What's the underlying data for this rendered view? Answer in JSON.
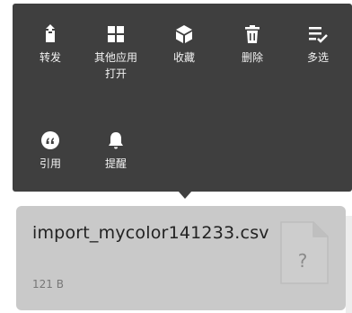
{
  "menu": {
    "items": [
      {
        "label": "转发",
        "icon": "share-icon"
      },
      {
        "label": "其他应用\n打开",
        "icon": "apps-icon"
      },
      {
        "label": "收藏",
        "icon": "favorite-box-icon"
      },
      {
        "label": "删除",
        "icon": "trash-icon"
      },
      {
        "label": "多选",
        "icon": "multi-select-icon"
      },
      {
        "label": "引用",
        "icon": "quote-icon"
      },
      {
        "label": "提醒",
        "icon": "bell-icon"
      }
    ]
  },
  "file": {
    "name": "import_mycolor141233.csv",
    "size": "121 B",
    "icon_glyph": "?"
  },
  "colors": {
    "menu_bg": "#3f3f3f",
    "card_bg": "#c9c9c9"
  }
}
